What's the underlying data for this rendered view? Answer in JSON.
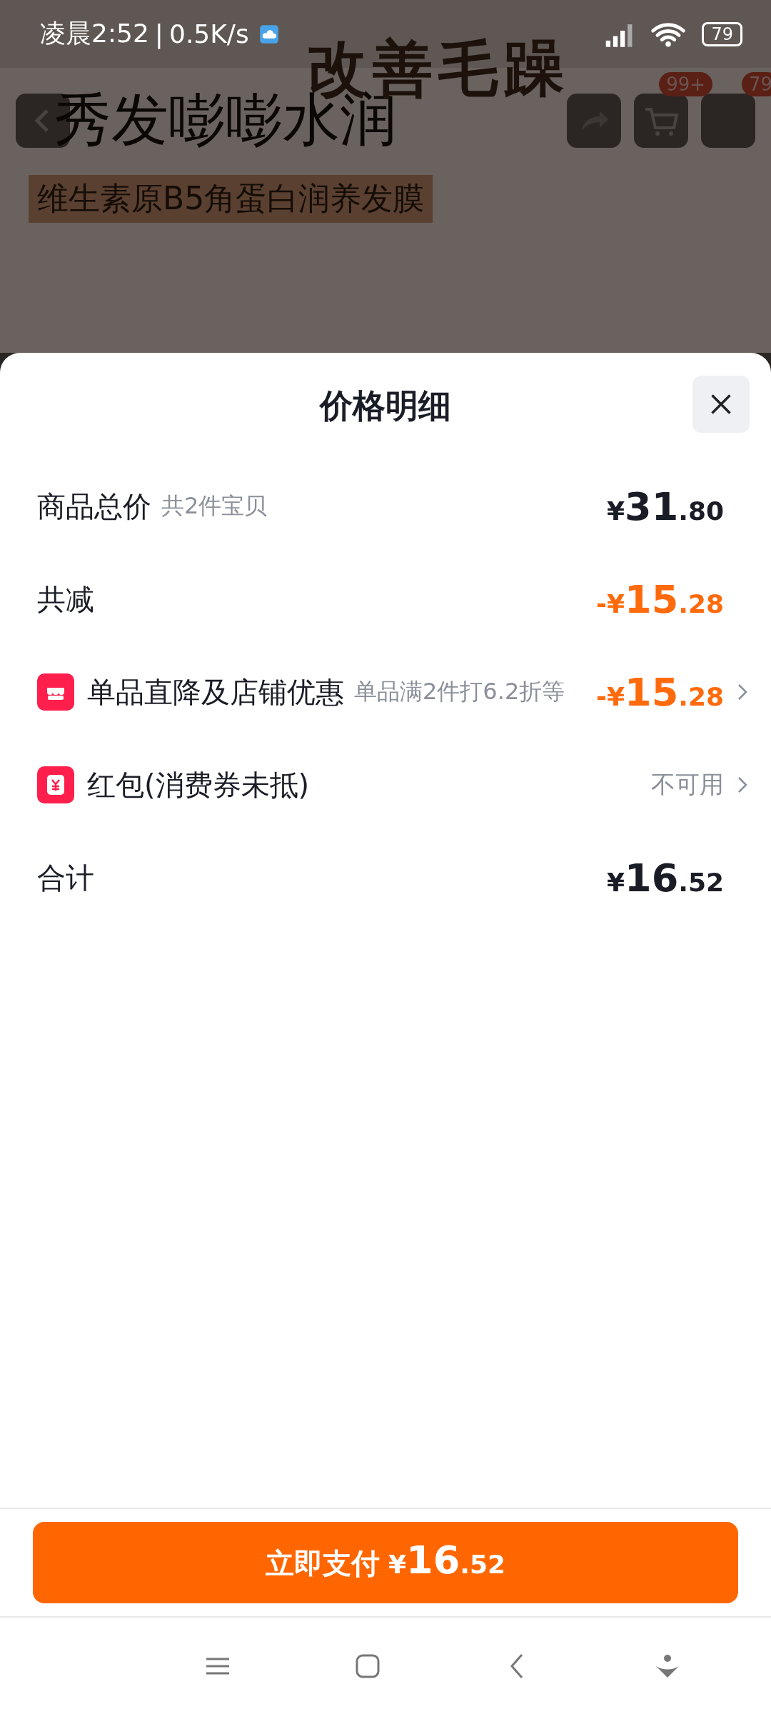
{
  "status_bar": {
    "time": "凌晨2:52",
    "separator": "|",
    "speed": "0.5K/s",
    "battery": "79"
  },
  "background_page": {
    "banner_title": "改善毛躁",
    "banner_subtitle": "秀发嘭嘭水润",
    "banner_tag": "维生素原B5角蛋白润养发膜",
    "cart_badge": "99+",
    "message_badge": "79"
  },
  "sheet": {
    "title": "价格明细",
    "rows": [
      {
        "kind": "plain",
        "label": "商品总价",
        "note": "共2件宝贝",
        "accent": false,
        "chevron": false,
        "price": {
          "currency": "¥",
          "integer": "31",
          "decimal": ".80"
        }
      },
      {
        "kind": "plain",
        "label": "共减",
        "accent": true,
        "chevron": false,
        "price": {
          "sign": "-",
          "currency": "¥",
          "integer": "15",
          "decimal": ".28"
        }
      },
      {
        "kind": "store",
        "label": "单品直降及店铺优惠",
        "note": "单品满2件打6.2折等",
        "accent": true,
        "chevron": true,
        "price": {
          "sign": "-",
          "currency": "¥",
          "integer": "15",
          "decimal": ".28"
        }
      },
      {
        "kind": "coupon",
        "label": "红包(消费券未抵)",
        "status": "不可用",
        "chevron": true
      },
      {
        "kind": "plain",
        "label": "合计",
        "accent": false,
        "chevron": false,
        "price": {
          "currency": "¥",
          "integer": "16",
          "decimal": ".52"
        }
      }
    ]
  },
  "pay_button": {
    "label": "立即支付",
    "currency": "¥",
    "integer": "16",
    "decimal": ".52"
  }
}
